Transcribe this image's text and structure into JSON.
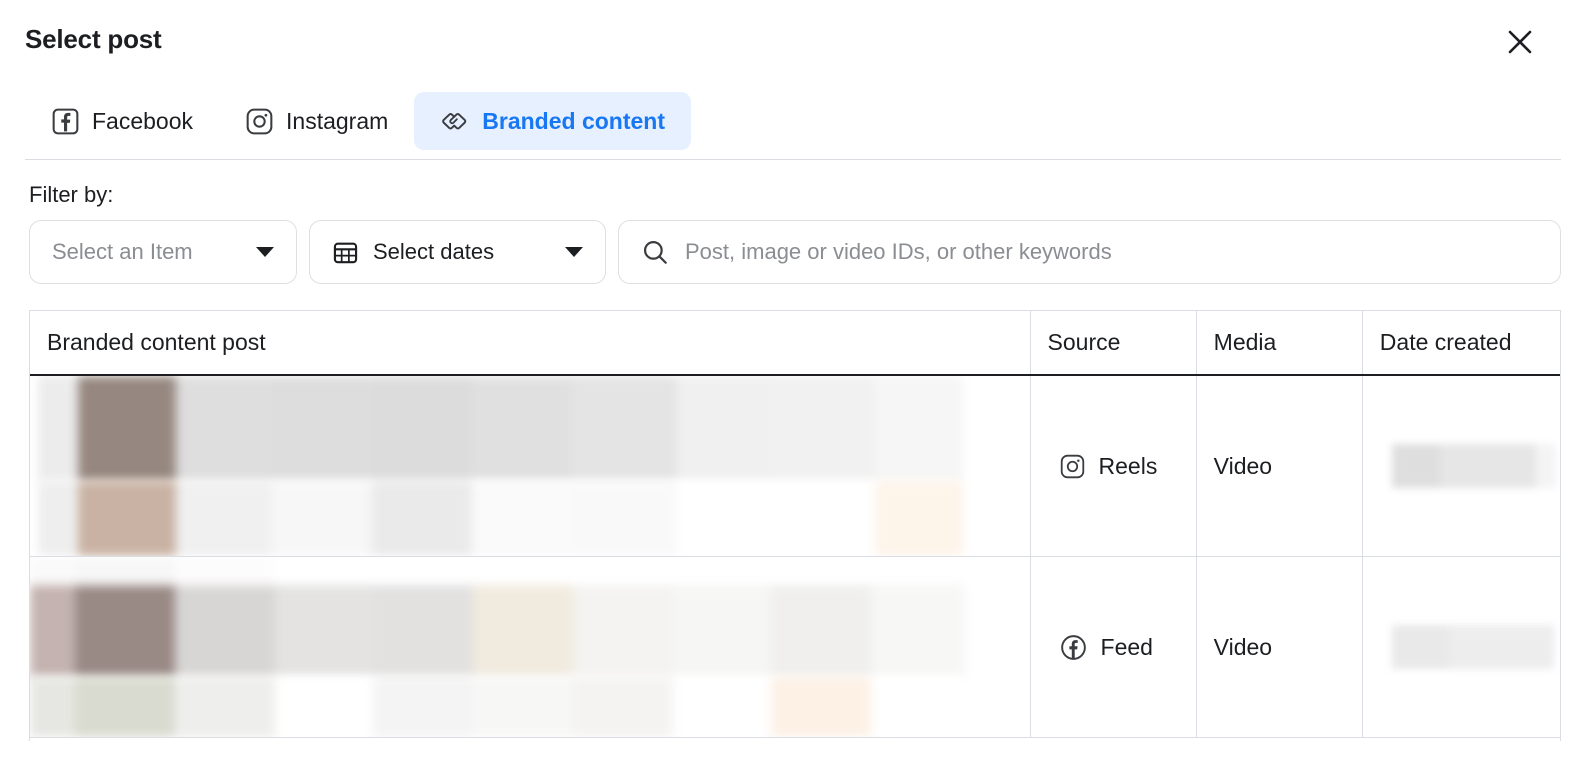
{
  "dialog": {
    "title": "Select post",
    "close_icon": "close-icon"
  },
  "tabs": [
    {
      "id": "facebook",
      "label": "Facebook",
      "icon": "facebook-square-icon",
      "active": false
    },
    {
      "id": "instagram",
      "label": "Instagram",
      "icon": "instagram-icon",
      "active": false
    },
    {
      "id": "branded-content",
      "label": "Branded content",
      "icon": "handshake-icon",
      "active": true
    }
  ],
  "filter": {
    "label": "Filter by:",
    "item_select": {
      "value": "Select an Item",
      "icon": "chevron-down-icon"
    },
    "date_select": {
      "value": "Select dates",
      "icon": "calendar-icon",
      "caret": "chevron-down-icon"
    },
    "search": {
      "placeholder": "Post, image or video IDs, or other keywords",
      "value": "",
      "icon": "search-icon"
    }
  },
  "table": {
    "columns": [
      {
        "key": "post",
        "label": "Branded content post"
      },
      {
        "key": "source",
        "label": "Source"
      },
      {
        "key": "media",
        "label": "Media"
      },
      {
        "key": "date",
        "label": "Date created"
      }
    ],
    "rows": [
      {
        "post_redacted": true,
        "source": "Reels",
        "source_icon": "instagram-icon",
        "media": "Video",
        "date_redacted": true
      },
      {
        "post_redacted": true,
        "source": "Feed",
        "source_icon": "facebook-circle-icon",
        "media": "Video",
        "date_redacted": true
      }
    ]
  },
  "colors": {
    "accent": "#1877f2",
    "active_tab_bg": "#e7f0fe",
    "text": "#1c1e21",
    "muted_text": "#8a8d91",
    "border": "#dadde1"
  }
}
